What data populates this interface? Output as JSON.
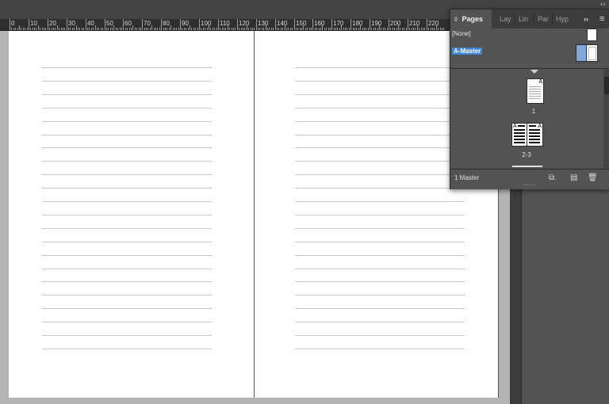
{
  "topbar": {
    "collapse_glyph": "‹‹"
  },
  "ruler": {
    "labels": [
      "0",
      "10",
      "20",
      "30",
      "40",
      "50",
      "60",
      "70",
      "80",
      "90",
      "100",
      "110",
      "120",
      "130",
      "140",
      "150",
      "160",
      "170",
      "180",
      "190",
      "200",
      "210",
      "220"
    ]
  },
  "panel": {
    "tabs": [
      {
        "label": "Pages",
        "glyph": "◊"
      },
      {
        "label": "Lay"
      },
      {
        "label": "Lin"
      },
      {
        "label": "Par"
      },
      {
        "label": "Hyp"
      }
    ],
    "overflow_glyph": "››",
    "menu_glyph": "≡",
    "masters": [
      {
        "label": "[None]"
      },
      {
        "label": "A-Master"
      }
    ],
    "pages": [
      {
        "label": "1"
      },
      {
        "label": "2-3"
      }
    ],
    "page_prefix": "A",
    "footer": {
      "count": "1 Master"
    },
    "icons": [
      "page-size-icon",
      "new-page-icon",
      "delete-page-icon"
    ]
  },
  "colors": {
    "accent": "#3d84dc",
    "panel_bg": "#535353",
    "ruler_bg": "#2f2f2f"
  }
}
